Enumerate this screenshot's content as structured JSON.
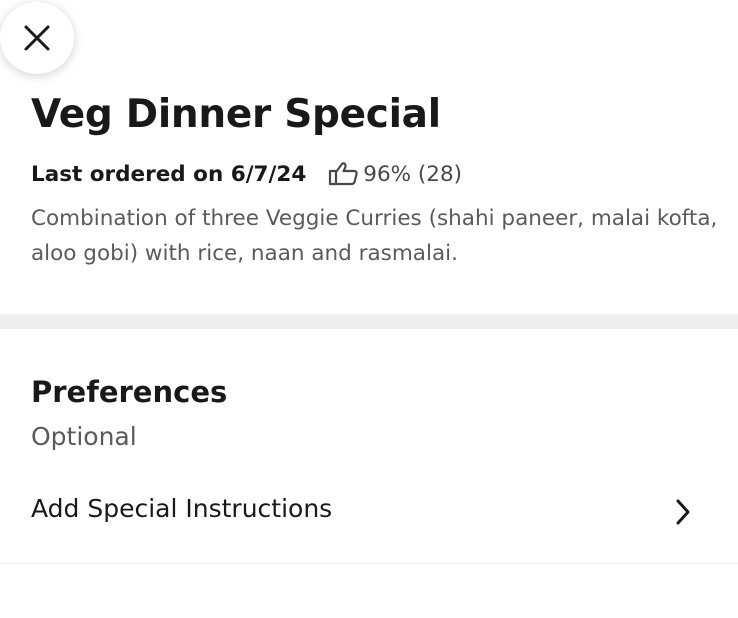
{
  "close_button": {
    "icon": "close-icon"
  },
  "item": {
    "title": "Veg Dinner Special",
    "last_ordered": "Last ordered on 6/7/24",
    "rating": {
      "icon": "thumbs-up-icon",
      "text": "96% (28)"
    },
    "description": "Combination of three Veggie Curries (shahi paneer, malai kofta, aloo gobi) with rice, naan and rasmalai."
  },
  "preferences": {
    "title": "Preferences",
    "subtitle": "Optional",
    "instructions_label": "Add Special Instructions",
    "chevron_icon": "chevron-right-icon"
  },
  "colors": {
    "text_primary": "#191919",
    "text_secondary": "#5a5a5a",
    "divider": "#eeeeee",
    "background": "#ffffff"
  }
}
